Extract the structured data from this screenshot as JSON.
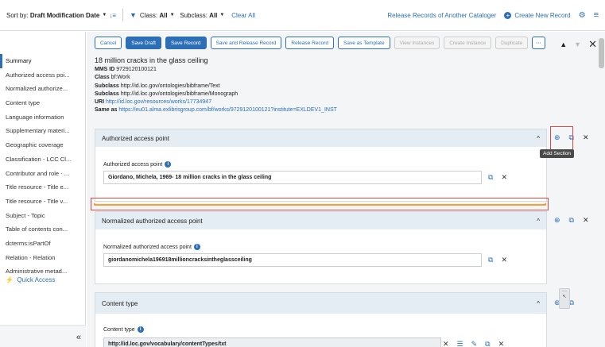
{
  "topbar": {
    "sort_label": "Sort by:",
    "sort_value": "Draft Modification Date",
    "class_label": "Class:",
    "class_value": "All",
    "subclass_label": "Subclass:",
    "subclass_value": "All",
    "clear_all": "Clear All",
    "release_other": "Release Records of Another Cataloger",
    "create_new": "Create New Record"
  },
  "toolbar": {
    "buttons": [
      "Cancel",
      "Save Draft",
      "Save Record",
      "Save and Release Record",
      "Release Record",
      "Save as Template",
      "View Instances",
      "Create Instance",
      "Duplicate",
      "···"
    ]
  },
  "record": {
    "title": "18 million cracks in the glass ceiling",
    "mms_label": "MMS ID",
    "mms_value": "9729120100121",
    "class_label": "Class",
    "class_value": "bf:Work",
    "subclass_label": "Subclass",
    "subclass_1": "http://id.loc.gov/ontologies/bibframe/Text",
    "subclass_2": "http://id.loc.gov/ontologies/bibframe/Monograph",
    "uri_label": "URI",
    "uri_value": "http://id.loc.gov/resources/works/17734947",
    "sameas_label": "Same as",
    "sameas_value": "https://eu01.alma.exlibrisgroup.com/bf/works/9729120100121?institute=EXLDEV1_INST"
  },
  "sidebar": {
    "items": [
      "Summary",
      "Authorized access poi...",
      "Normalized authorize...",
      "Content type",
      "Language information",
      "Supplementary materi...",
      "Geographic coverage",
      "Classification - LCC Cl...",
      "Contributor and role - ...",
      "Title resource - Title e...",
      "Title resource - Title v...",
      "Subject - Topic",
      "Table of contents con...",
      "dcterms:isPartOf",
      "Relation - Relation",
      "Administrative metad..."
    ],
    "quick_access": "Quick Access"
  },
  "sections": {
    "s1_title": "Authorized access point",
    "s1_field_label": "Authorized access point",
    "s1_field_value": "Giordano, Michela, 1969- 18 million cracks in the glass ceiling",
    "s2_title": "Normalized authorized access point",
    "s2_field_label": "Normalized authorized access point",
    "s2_field_value": "giordanomichela196918millioncracksintheglassceiling",
    "s3_title": "Content type",
    "s3_field_label": "Content type",
    "s3_field_value": "http://id.loc.gov/vocabulary/contentTypes/txt"
  },
  "tooltip": "Add Section",
  "colors": {
    "accent": "#2c6fb7",
    "section_header": "#e4edf4",
    "highlight": "#e04848",
    "drop_indicator": "#f2a230"
  }
}
